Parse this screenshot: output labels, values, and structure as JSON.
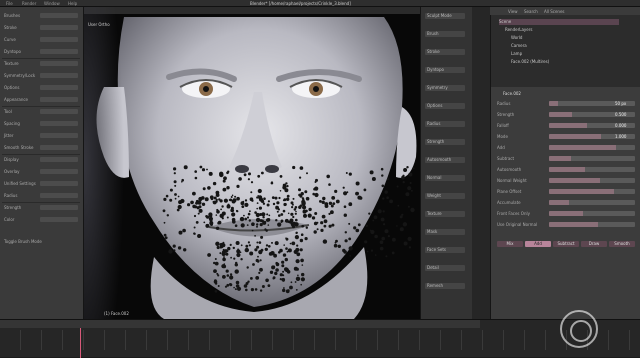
{
  "window": {
    "title": "Blender* [/home/raphael/projects/Crinkle_3.blend]"
  },
  "menu": [
    "File",
    "Render",
    "Window",
    "Help"
  ],
  "left_panel": {
    "rows": [
      "Brushes",
      "Stroke",
      "Curve",
      "Dyntopo",
      "Texture",
      "Symmetry/Lock",
      "Options",
      "Appearance",
      "Tool",
      "Spacing",
      "Jitter",
      "Smooth Stroke",
      "Display",
      "Overlay",
      "Unified Settings",
      "Radius",
      "Strength",
      "Color"
    ],
    "footer": "Toggle Brush Mode"
  },
  "viewport": {
    "label": "User Ortho",
    "footer": "(1) Face.002"
  },
  "sculpt_column": {
    "items": [
      "Sculpt Mode",
      "Brush",
      "Stroke",
      "Dyntopo",
      "Symmetry",
      "Options",
      "Radius",
      "Strength",
      "Autosmooth",
      "Normal",
      "Weight",
      "Texture",
      "Mask",
      "Face Sets",
      "Detail",
      "Remesh"
    ]
  },
  "outliner": {
    "header": [
      "View",
      "Search",
      "All Scenes"
    ],
    "rows": [
      "Scene",
      "RenderLayers",
      "World",
      "Camera",
      "Lamp",
      "Face.002 (Multires)"
    ]
  },
  "properties": {
    "title": "Face.002",
    "labels": [
      "Radius",
      "Strength",
      "Falloff",
      "Mode",
      "Add",
      "Subtract",
      "Autosmooth",
      "Normal Weight",
      "Plane Offset",
      "Accumulate",
      "Front Faces Only",
      "Use Original Normal"
    ],
    "values": [
      "50 px",
      "0.500",
      "0.000",
      "1.000"
    ],
    "buttons": [
      "Mix",
      "Add",
      "Subtract",
      "Draw",
      "Smooth"
    ]
  },
  "colors": {
    "accent": "#b8849a",
    "panel": "#3c3c3c",
    "viewport_bg": "#080808"
  },
  "icons": [
    "closed-captions-icon"
  ]
}
